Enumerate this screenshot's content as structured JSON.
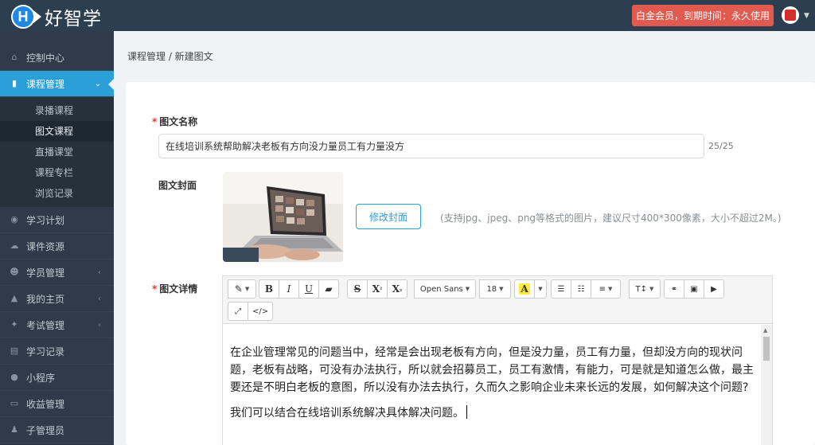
{
  "app": {
    "logo_letter": "H",
    "logo_text": "好智学"
  },
  "header": {
    "vip_text": "白金会员，到期时间：永久使用"
  },
  "sidebar": {
    "items": [
      {
        "label": "控制中心",
        "icon": "home-icon"
      },
      {
        "label": "课程管理",
        "icon": "book-icon",
        "active": true
      },
      {
        "label": "学习计划",
        "icon": "eye-icon"
      },
      {
        "label": "课件资源",
        "icon": "cloud-icon"
      },
      {
        "label": "学员管理",
        "icon": "users-icon"
      },
      {
        "label": "我的主页",
        "icon": "graduation-icon"
      },
      {
        "label": "考试管理",
        "icon": "paw-icon"
      },
      {
        "label": "学习记录",
        "icon": "record-icon"
      },
      {
        "label": "小程序",
        "icon": "chat-icon"
      },
      {
        "label": "收益管理",
        "icon": "card-icon"
      },
      {
        "label": "子管理员",
        "icon": "user-icon"
      }
    ],
    "sub_items": [
      "录播课程",
      "图文课程",
      "直播课堂",
      "课程专栏",
      "浏览记录"
    ]
  },
  "breadcrumb": "课程管理 / 新建图文",
  "form": {
    "title_label": "图文名称",
    "title_value": "在线培训系统帮助解决老板有方向没力量员工有力量没方",
    "title_counter": "25/25",
    "cover_label": "图文封面",
    "cover_button": "修改封面",
    "cover_hint": "(支持jpg、jpeg、png等格式的图片，建议尺寸400*300像素，大小不超过2M。)",
    "detail_label": "图文详情"
  },
  "editor": {
    "font_family": "Open Sans",
    "font_size": "18",
    "paragraphs": [
      "在企业管理常见的问题当中，经常是会出现老板有方向，但是没力量，员工有力量，但却没方向的现状问题，老板有战略，可没有办法执行，所以就会招募员工，员工有激情，有能力，可是就是知道怎么做，最主要还是不明白老板的意图，所以没有办法去执行，久而久之影响企业未来长远的发展，如何解决这个问题?",
      "我们可以结合在线培训系统解决具体解决问题。"
    ]
  },
  "colors": {
    "accent": "#2a9fd8",
    "sidebar": "#2f3b48",
    "topbar": "#2c3e50",
    "vip": "#e05a4f"
  }
}
